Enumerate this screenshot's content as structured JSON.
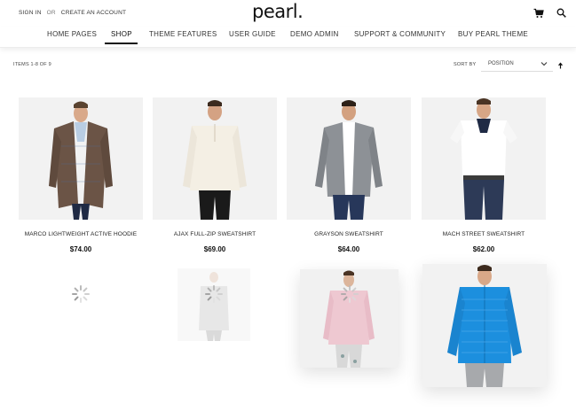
{
  "header": {
    "sign_in": "SIGN IN",
    "or": "OR",
    "create_account": "CREATE AN ACCOUNT",
    "logo": "pearl.",
    "cart_icon": "cart-icon",
    "search_icon": "search-icon"
  },
  "nav": {
    "items": [
      {
        "label": "HOME PAGES"
      },
      {
        "label": "SHOP"
      },
      {
        "label": "THEME FEATURES"
      },
      {
        "label": "USER GUIDE"
      },
      {
        "label": "DEMO ADMIN"
      },
      {
        "label": "SUPPORT & COMMUNITY"
      },
      {
        "label": "BUY PEARL THEME"
      }
    ],
    "active": "SHOP"
  },
  "toolbar": {
    "count": "ITEMS 1-8 OF 9",
    "sort_label": "SORT BY",
    "sort_value": "POSITION",
    "sort_direction_icon": "arrow-up-icon"
  },
  "products": [
    {
      "name": "MARCO LIGHTWEIGHT ACTIVE HOODIE",
      "price": "$74.00"
    },
    {
      "name": "AJAX FULL-ZIP SWEATSHIRT",
      "price": "$69.00"
    },
    {
      "name": "GRAYSON SWEATSHIRT",
      "price": "$64.00"
    },
    {
      "name": "MACH STREET SWEATSHIRT",
      "price": "$62.00"
    }
  ],
  "colors": {
    "jacket_blue": "#1c8fde",
    "accent": "#111111"
  }
}
